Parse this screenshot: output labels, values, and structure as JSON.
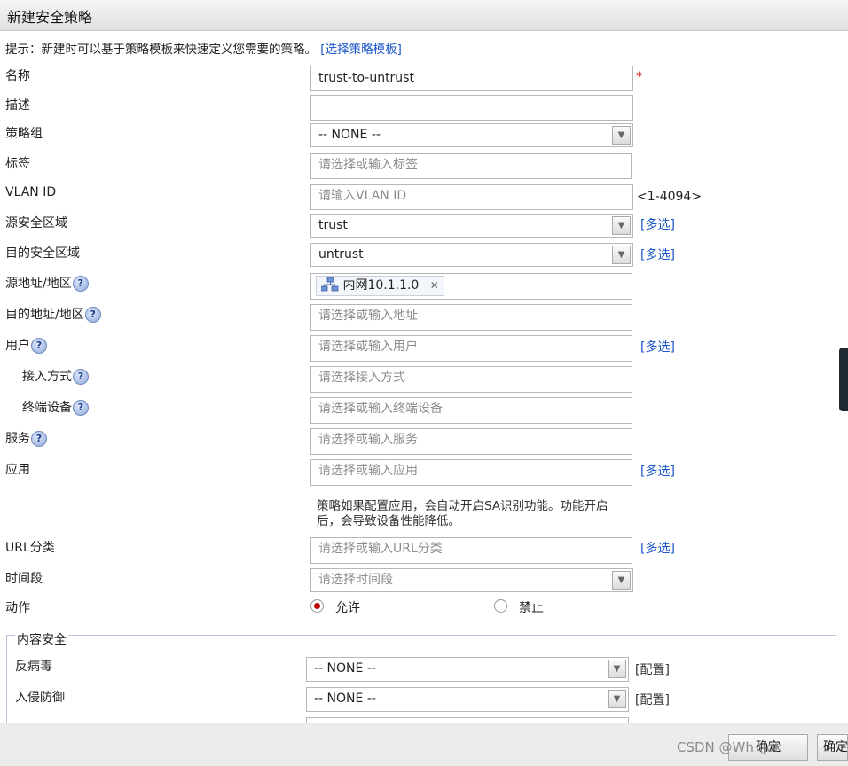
{
  "dialog": {
    "title": "新建安全策略"
  },
  "hint": {
    "text": "提示：新建时可以基于策略模板来快速定义您需要的策略。",
    "link": "[选择策略模板]"
  },
  "fields": {
    "name": {
      "label": "名称",
      "value": "trust-to-untrust",
      "required_mark": "*"
    },
    "description": {
      "label": "描述",
      "value": ""
    },
    "policy_group": {
      "label": "策略组",
      "value": "-- NONE --"
    },
    "tag": {
      "label": "标签",
      "placeholder": "请选择或输入标签"
    },
    "vlan": {
      "label": "VLAN ID",
      "placeholder": "请输入VLAN ID",
      "range": "<1-4094>"
    },
    "src_zone": {
      "label": "源安全区域",
      "value": "trust",
      "multi": "[多选]"
    },
    "dst_zone": {
      "label": "目的安全区域",
      "value": "untrust",
      "multi": "[多选]"
    },
    "src_addr": {
      "label": "源地址/地区",
      "help": "?",
      "tag_label": "内网10.1.1.0",
      "tag_close": "✕"
    },
    "dst_addr": {
      "label": "目的地址/地区",
      "help": "?",
      "placeholder": "请选择或输入地址"
    },
    "user": {
      "label": "用户",
      "help": "?",
      "placeholder": "请选择或输入用户",
      "multi": "[多选]"
    },
    "access_mode": {
      "label": "接入方式",
      "help": "?",
      "placeholder": "请选择接入方式"
    },
    "terminal": {
      "label": "终端设备",
      "help": "?",
      "placeholder": "请选择或输入终端设备"
    },
    "service": {
      "label": "服务",
      "help": "?",
      "placeholder": "请选择或输入服务"
    },
    "application": {
      "label": "应用",
      "placeholder": "请选择或输入应用",
      "multi": "[多选]",
      "note_line1": "策略如果配置应用，会自动开启SA识别功能。功能开启",
      "note_line2": "后，会导致设备性能降低。"
    },
    "url": {
      "label": "URL分类",
      "placeholder": "请选择或输入URL分类",
      "multi": "[多选]"
    },
    "time": {
      "label": "时间段",
      "placeholder": "请选择时间段"
    },
    "action": {
      "label": "动作",
      "allow": "允许",
      "deny": "禁止",
      "selected": "允许"
    }
  },
  "content_security": {
    "legend": "内容安全",
    "antivirus": {
      "label": "反病毒",
      "value": "-- NONE --",
      "config": "[配置]"
    },
    "ips": {
      "label": "入侵防御",
      "value": "-- NONE --",
      "config": "[配置]"
    }
  },
  "footer": {
    "ok1": "确定",
    "ok2": "确定",
    "watermark": "CSDN @Wh  \\jok"
  },
  "icons": {
    "dropdown": "▼",
    "network": "network-icon"
  },
  "colors": {
    "link": "#1a55c9",
    "required": "#dd2222",
    "radio_on": "#bb0000"
  }
}
